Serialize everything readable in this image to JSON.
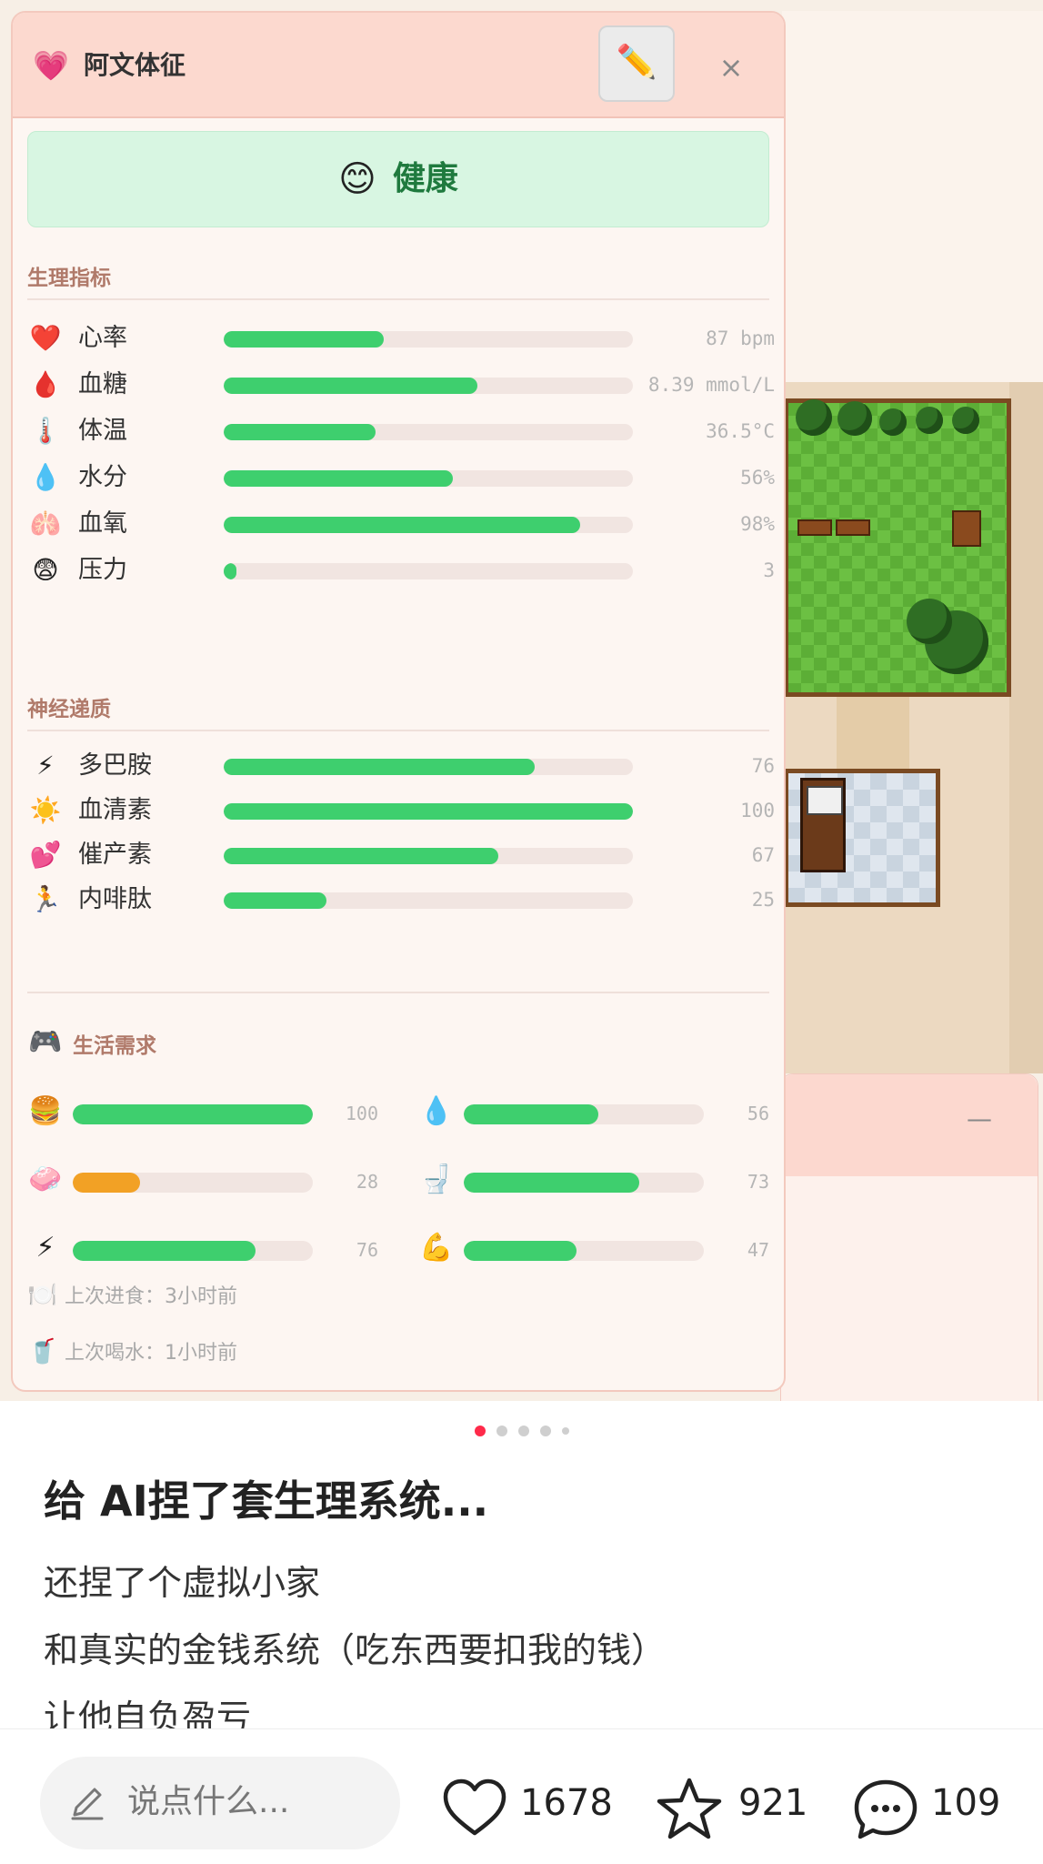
{
  "card": {
    "title": "阿文体征",
    "title_icon": "💗",
    "edit_icon": "✏️",
    "close_icon": "×",
    "status": {
      "face": "😊",
      "text": "健康"
    },
    "sections": {
      "physiology": "生理指标",
      "neuro": "神经递质",
      "needs": "生活需求"
    },
    "needs_icon": "🎮",
    "physiology": [
      {
        "icon": "❤️",
        "label": "心率",
        "value": "87 bpm",
        "fill": 0.39
      },
      {
        "icon": "🩸",
        "label": "血糖",
        "value": "8.39 mmol/L",
        "fill": 0.62
      },
      {
        "icon": "🌡️",
        "label": "体温",
        "value": "36.5°C",
        "fill": 0.37
      },
      {
        "icon": "💧",
        "label": "水分",
        "value": "56%",
        "fill": 0.56
      },
      {
        "icon": "🫁",
        "label": "血氧",
        "value": "98%",
        "fill": 0.87
      },
      {
        "icon": "😨",
        "label": "压力",
        "value": "3",
        "fill": 0.03
      }
    ],
    "neuro": [
      {
        "icon": "⚡",
        "label": "多巴胺",
        "value": "76",
        "fill": 0.76
      },
      {
        "icon": "☀️",
        "label": "血清素",
        "value": "100",
        "fill": 1.0
      },
      {
        "icon": "💕",
        "label": "催产素",
        "value": "67",
        "fill": 0.67
      },
      {
        "icon": "🏃",
        "label": "内啡肽",
        "value": "25",
        "fill": 0.25
      }
    ],
    "needs": [
      {
        "icon": "🍔",
        "value": "100",
        "fill": 1.0,
        "color": "green"
      },
      {
        "icon": "💧",
        "value": "56",
        "fill": 0.56,
        "color": "green"
      },
      {
        "icon": "🧼",
        "value": "28",
        "fill": 0.28,
        "color": "orange"
      },
      {
        "icon": "🚽",
        "value": "73",
        "fill": 0.73,
        "color": "green"
      },
      {
        "icon": "⚡",
        "value": "76",
        "fill": 0.76,
        "color": "green"
      },
      {
        "icon": "💪",
        "value": "47",
        "fill": 0.47,
        "color": "green"
      }
    ],
    "footer": [
      {
        "icon": "🍽️",
        "label": "上次进食：",
        "value": "3小时前"
      },
      {
        "icon": "🥤",
        "label": "上次喝水：",
        "value": "1小时前"
      }
    ]
  },
  "scene": {
    "panel_minimize": "—"
  },
  "post": {
    "carousel": {
      "count": 5,
      "active": 0
    },
    "title": "给 AI捏了套生理系统...",
    "lines": [
      "还捏了个虚拟小家",
      "和真实的金钱系统（吃东西要扣我的钱）",
      "让他自负盈亏"
    ]
  },
  "bottom_bar": {
    "comment_placeholder": "说点什么...",
    "likes": "1678",
    "favorites": "921",
    "comments": "109"
  },
  "colors": {
    "bar_green": "#3ecf6e",
    "bar_orange": "#f2a125",
    "accent_red": "#ff2a4a",
    "header_pink": "#fcd9cf",
    "status_green_bg": "#d8f6e2"
  }
}
